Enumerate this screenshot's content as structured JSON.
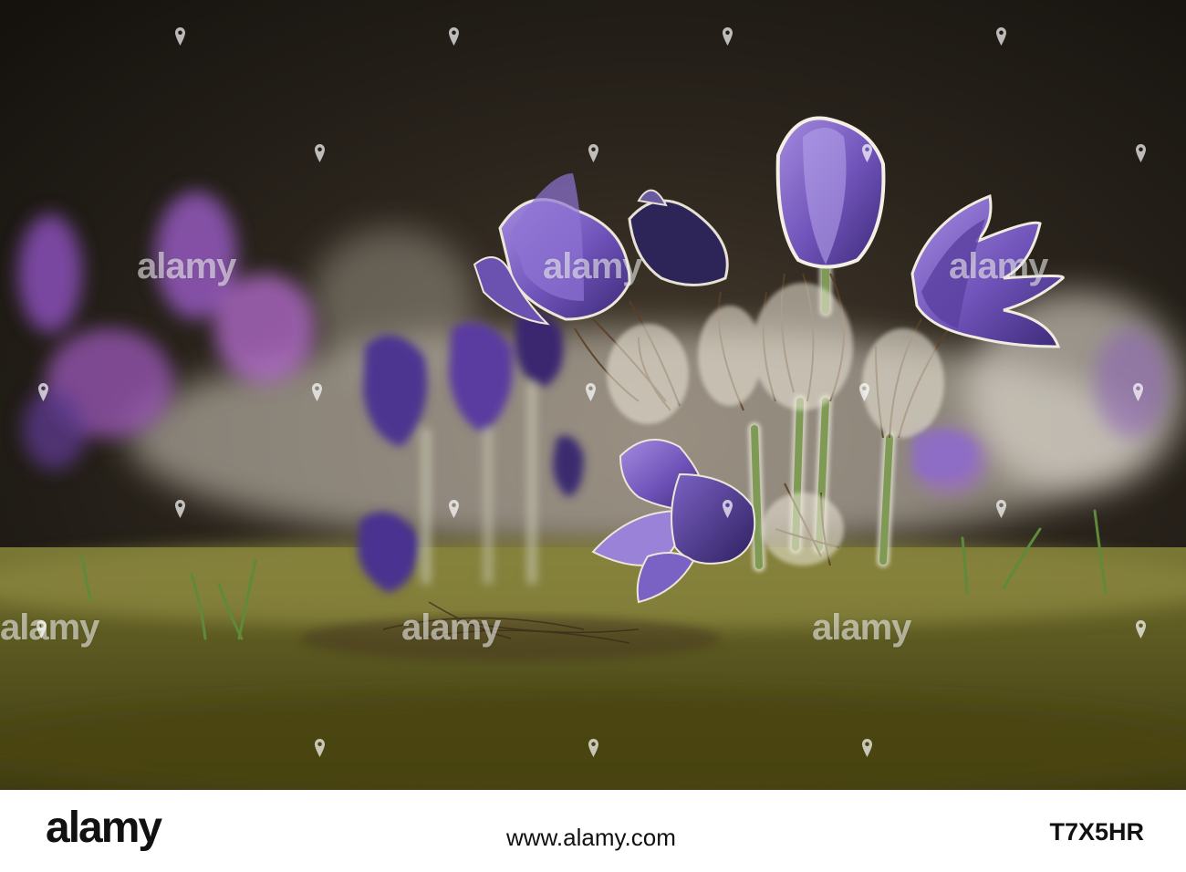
{
  "photo": {
    "subject": "pasque flowers",
    "colors": {
      "background_dark": "#1d1a16",
      "petal_purple": "#6a4fb0",
      "petal_light": "#9a82d8",
      "grass": "#6b6a2a",
      "stem": "#7e9a55"
    }
  },
  "watermark": {
    "text": "alamy"
  },
  "footer": {
    "logo": "alamy",
    "url": "www.alamy.com",
    "image_id": "T7X5HR"
  }
}
